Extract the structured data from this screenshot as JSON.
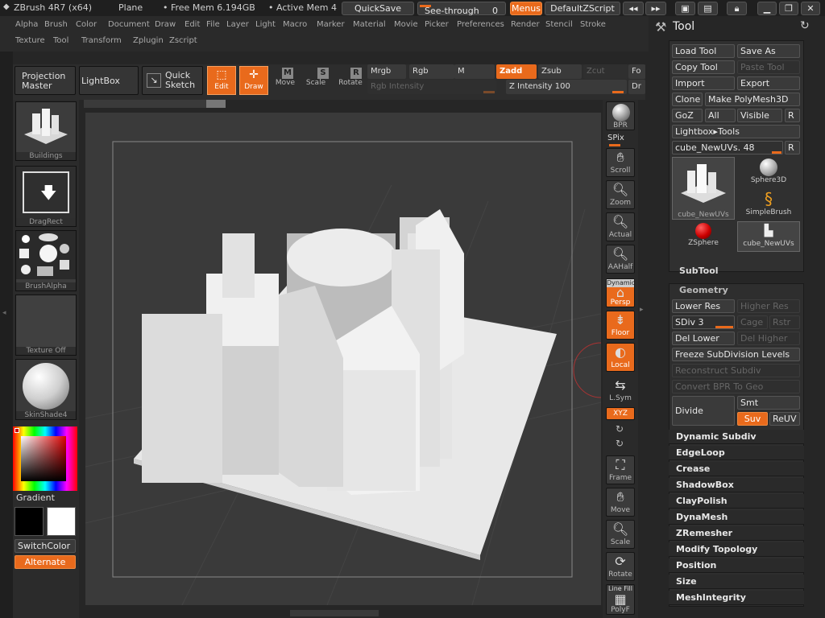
{
  "titlebar": {
    "app": "ZBrush 4R7 (x64)",
    "doc": "Plane",
    "free_mem": "• Free Mem 6.194GB",
    "active_mem": "• Active Mem 4",
    "quicksave": "QuickSave",
    "see_through": "See-through",
    "see_through_value": "0",
    "menus": "Menus",
    "default_script": "DefaultZScript"
  },
  "menus": {
    "row1": [
      "Alpha",
      "Brush",
      "Color",
      "Document",
      "Draw",
      "Edit",
      "File",
      "Layer",
      "Light",
      "Macro",
      "Marker",
      "Material",
      "Movie",
      "Picker",
      "Preferences",
      "Render",
      "Stencil",
      "Stroke"
    ],
    "row2": [
      "Texture",
      "Tool",
      "Transform",
      "Zplugin",
      "Zscript"
    ]
  },
  "top": {
    "projection_master": "Projection Master",
    "lightbox": "LightBox",
    "quick_sketch": "Quick Sketch",
    "edit": "Edit",
    "draw": "Draw",
    "move": "Move",
    "scale": "Scale",
    "rotate": "Rotate",
    "mrgb": "Mrgb",
    "rgb": "Rgb",
    "m": "M",
    "zadd": "Zadd",
    "zsub": "Zsub",
    "zcut": "Zcut",
    "rgb_intensity": "Rgb Intensity",
    "z_intensity": "Z Intensity 100",
    "focal": "Fo",
    "draw_size": "Dr"
  },
  "left": {
    "buildings": "Buildings",
    "dragrect": "DragRect",
    "brushalpha": "BrushAlpha",
    "texture_off": "Texture Off",
    "skinshade": "SkinShade4",
    "gradient": "Gradient",
    "switchcolor": "SwitchColor",
    "alternate": "Alternate"
  },
  "right_tools": {
    "bpr": "BPR",
    "spix": "SPix",
    "scroll": "Scroll",
    "zoom": "Zoom",
    "actual": "Actual",
    "aahalf": "AAHalf",
    "dynamic": "Dynamic",
    "persp": "Persp",
    "floor": "Floor",
    "local": "Local",
    "lsym": "L.Sym",
    "xyz": "XYZ",
    "frame": "Frame",
    "move": "Move",
    "scale": "Scale",
    "rotate": "Rotate",
    "line_fill": "Line Fill",
    "polyf": "PolyF"
  },
  "tool_panel": {
    "title": "Tool",
    "load_tool": "Load Tool",
    "save_as": "Save As",
    "copy_tool": "Copy Tool",
    "paste_tool": "Paste Tool",
    "import": "Import",
    "export": "Export",
    "clone": "Clone",
    "make_polymesh": "Make PolyMesh3D",
    "goz": "GoZ",
    "all": "All",
    "visible": "Visible",
    "r": "R",
    "lightbox_tools": "Lightbox▸Tools",
    "current_tool": "cube_NewUVs. 48",
    "tools": [
      "cube_NewUVs",
      "Sphere3D",
      "SimpleBrush",
      "ZSphere",
      "cube_NewUVs"
    ],
    "subtool": "SubTool",
    "geometry": "Geometry",
    "lower_res": "Lower Res",
    "higher_res": "Higher Res",
    "sdiv": "SDiv 3",
    "cage": "Cage",
    "rstr": "Rstr",
    "del_lower": "Del Lower",
    "del_higher": "Del Higher",
    "freeze": "Freeze SubDivision Levels",
    "reconstruct": "Reconstruct Subdiv",
    "convert_bpr": "Convert BPR To Geo",
    "divide": "Divide",
    "smt": "Smt",
    "suv": "Suv",
    "reuv": "ReUV",
    "sections": [
      "Dynamic Subdiv",
      "EdgeLoop",
      "Crease",
      "ShadowBox",
      "ClayPolish",
      "DynaMesh",
      "ZRemesher",
      "Modify Topology",
      "Position",
      "Size",
      "MeshIntegrity"
    ]
  },
  "colors": {
    "accent": "#e96a1c",
    "panel": "#262626"
  }
}
